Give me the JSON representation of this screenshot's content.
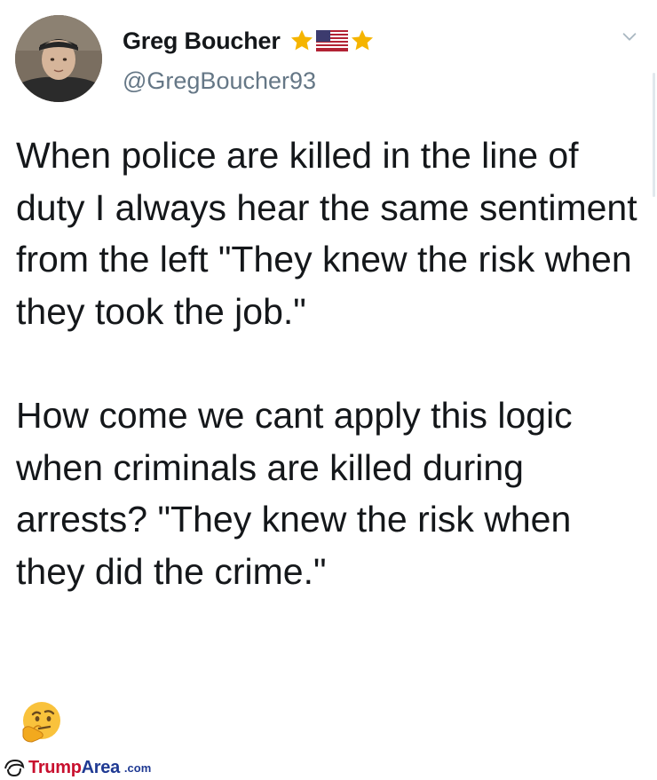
{
  "user": {
    "display_name": "Greg Boucher",
    "handle": "@GregBoucher93"
  },
  "badges": [
    "star-icon",
    "us-flag-icon",
    "star-icon"
  ],
  "tweet": {
    "paragraph_1": "When police are killed in the line of duty I always hear the same sentiment from the left \"They knew the risk when they took the job.\"",
    "paragraph_2": "How come we cant apply this logic when criminals are killed during arrests? \"They knew the risk when they did the crime.\"",
    "emoji": "thinking-face-icon"
  },
  "watermark": {
    "brand_part1": "Trump",
    "brand_part2": "Area",
    "suffix": ".com"
  },
  "colors": {
    "name": "#14171a",
    "handle": "#657786",
    "star": "#f5b400",
    "watermark_red": "#c8102e",
    "watermark_blue": "#1f3a93"
  }
}
